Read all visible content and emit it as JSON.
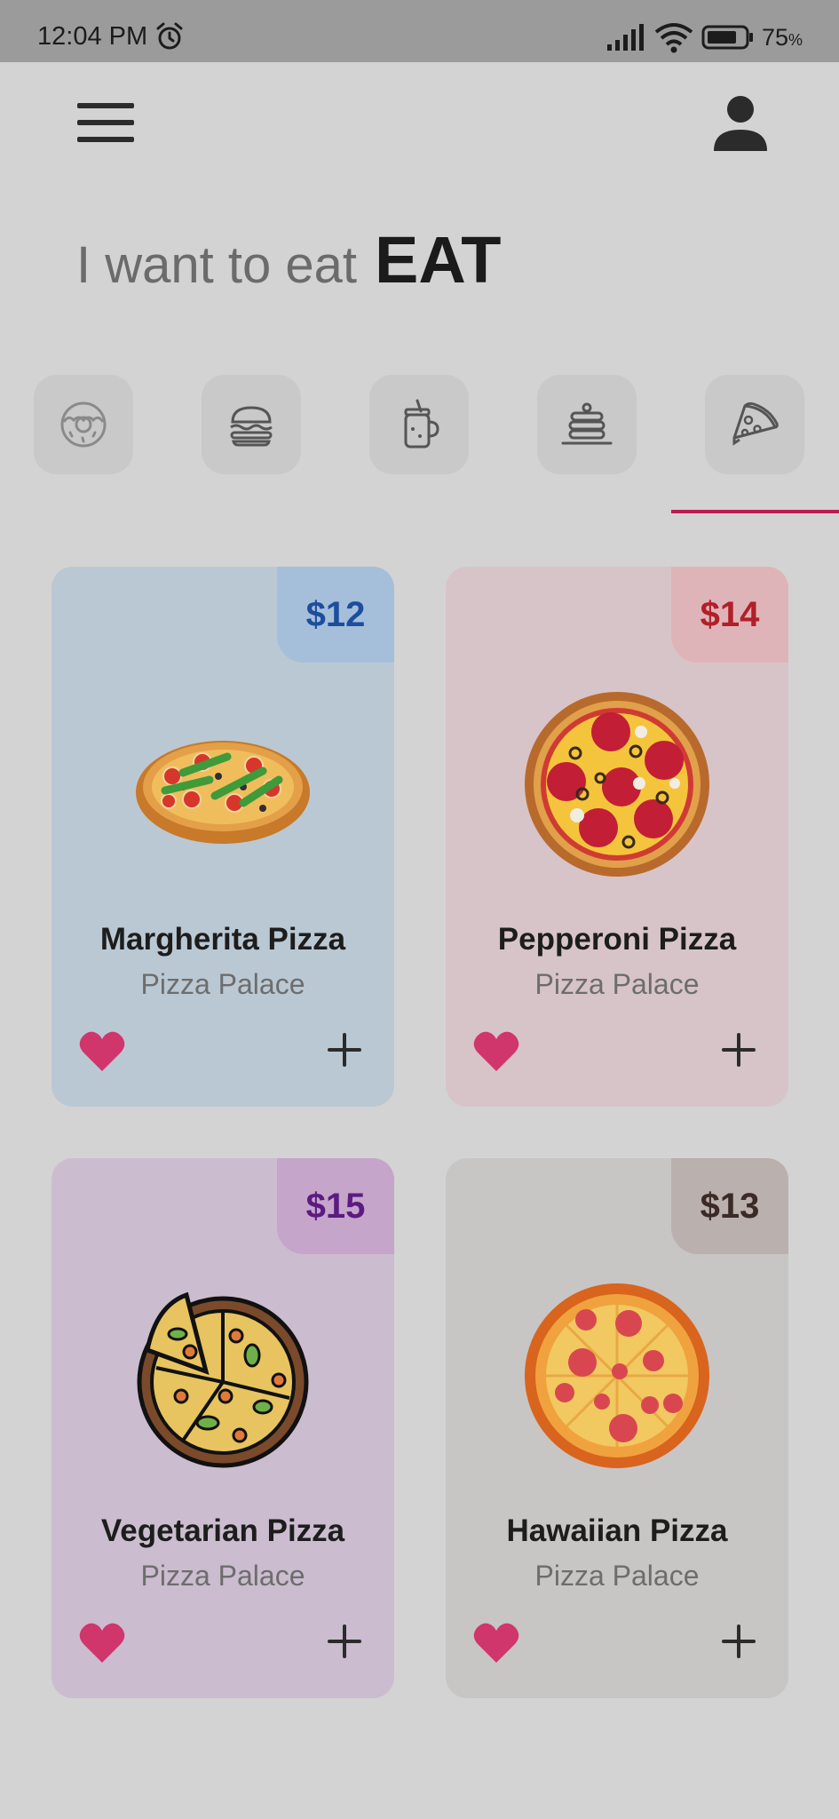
{
  "status_bar": {
    "time": "12:04 PM",
    "battery_percent": "75",
    "battery_percent_sign": "%"
  },
  "header": {
    "menu_icon": "hamburger-menu-icon",
    "profile_icon": "person-icon"
  },
  "headline": {
    "lead": "I want to eat",
    "emphasis": "EAT"
  },
  "categories": [
    {
      "icon": "donut-icon",
      "selected": false
    },
    {
      "icon": "burger-icon",
      "selected": false
    },
    {
      "icon": "drink-jar-icon",
      "selected": false
    },
    {
      "icon": "pancakes-icon",
      "selected": false
    },
    {
      "icon": "pizza-slice-icon",
      "selected": true
    }
  ],
  "products": [
    {
      "name": "Margherita Pizza",
      "restaurant": "Pizza Palace",
      "price": "$12",
      "card_color": "#bac8d3",
      "badge_color": "#a5bfdb",
      "price_color": "#1d4e9b",
      "image": "margherita-pizza-image"
    },
    {
      "name": "Pepperoni Pizza",
      "restaurant": "Pizza Palace",
      "price": "$14",
      "card_color": "#d7c4c8",
      "badge_color": "#dfb4b8",
      "price_color": "#b0202a",
      "image": "pepperoni-pizza-image"
    },
    {
      "name": "Vegetarian Pizza",
      "restaurant": "Pizza Palace",
      "price": "$15",
      "card_color": "#cbbccf",
      "badge_color": "#c5a5ca",
      "price_color": "#5b1b80",
      "image": "vegetarian-pizza-image"
    },
    {
      "name": "Hawaiian Pizza",
      "restaurant": "Pizza Palace",
      "price": "$13",
      "card_color": "#c8c5c5",
      "badge_color": "#bab0ae",
      "price_color": "#3b2a26",
      "image": "hawaiian-pizza-image"
    }
  ],
  "accent_color": "#b91e4e",
  "favorite_color": "#d0356c"
}
